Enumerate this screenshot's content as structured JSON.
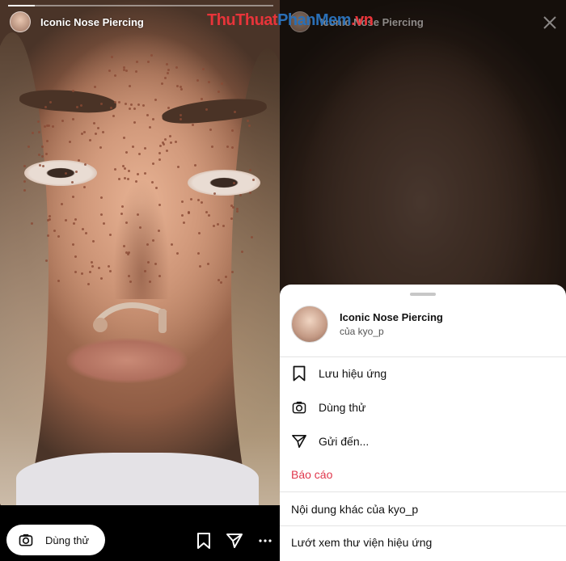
{
  "story": {
    "effect_title": "Iconic Nose Piercing",
    "try_button_label": "Dùng thử"
  },
  "watermark": {
    "part1": "ThuThuat",
    "part2": "PhanMem",
    "part3": ".vn"
  },
  "sheet": {
    "effect_name": "Iconic Nose Piercing",
    "effect_by": "của kyo_p",
    "items": [
      {
        "label": "Lưu hiệu ứng",
        "icon": "bookmark-icon"
      },
      {
        "label": "Dùng thử",
        "icon": "camera-icon"
      },
      {
        "label": "Gửi đến...",
        "icon": "send-icon"
      }
    ],
    "report_label": "Báo cáo",
    "more_from_creator": "Nội dung khác của kyo_p",
    "browse_gallery": "Lướt xem thư viện hiệu ứng"
  },
  "colors": {
    "report": "#e0374c",
    "sheet_bg": "#ffffff",
    "bar_bg": "#000000"
  }
}
